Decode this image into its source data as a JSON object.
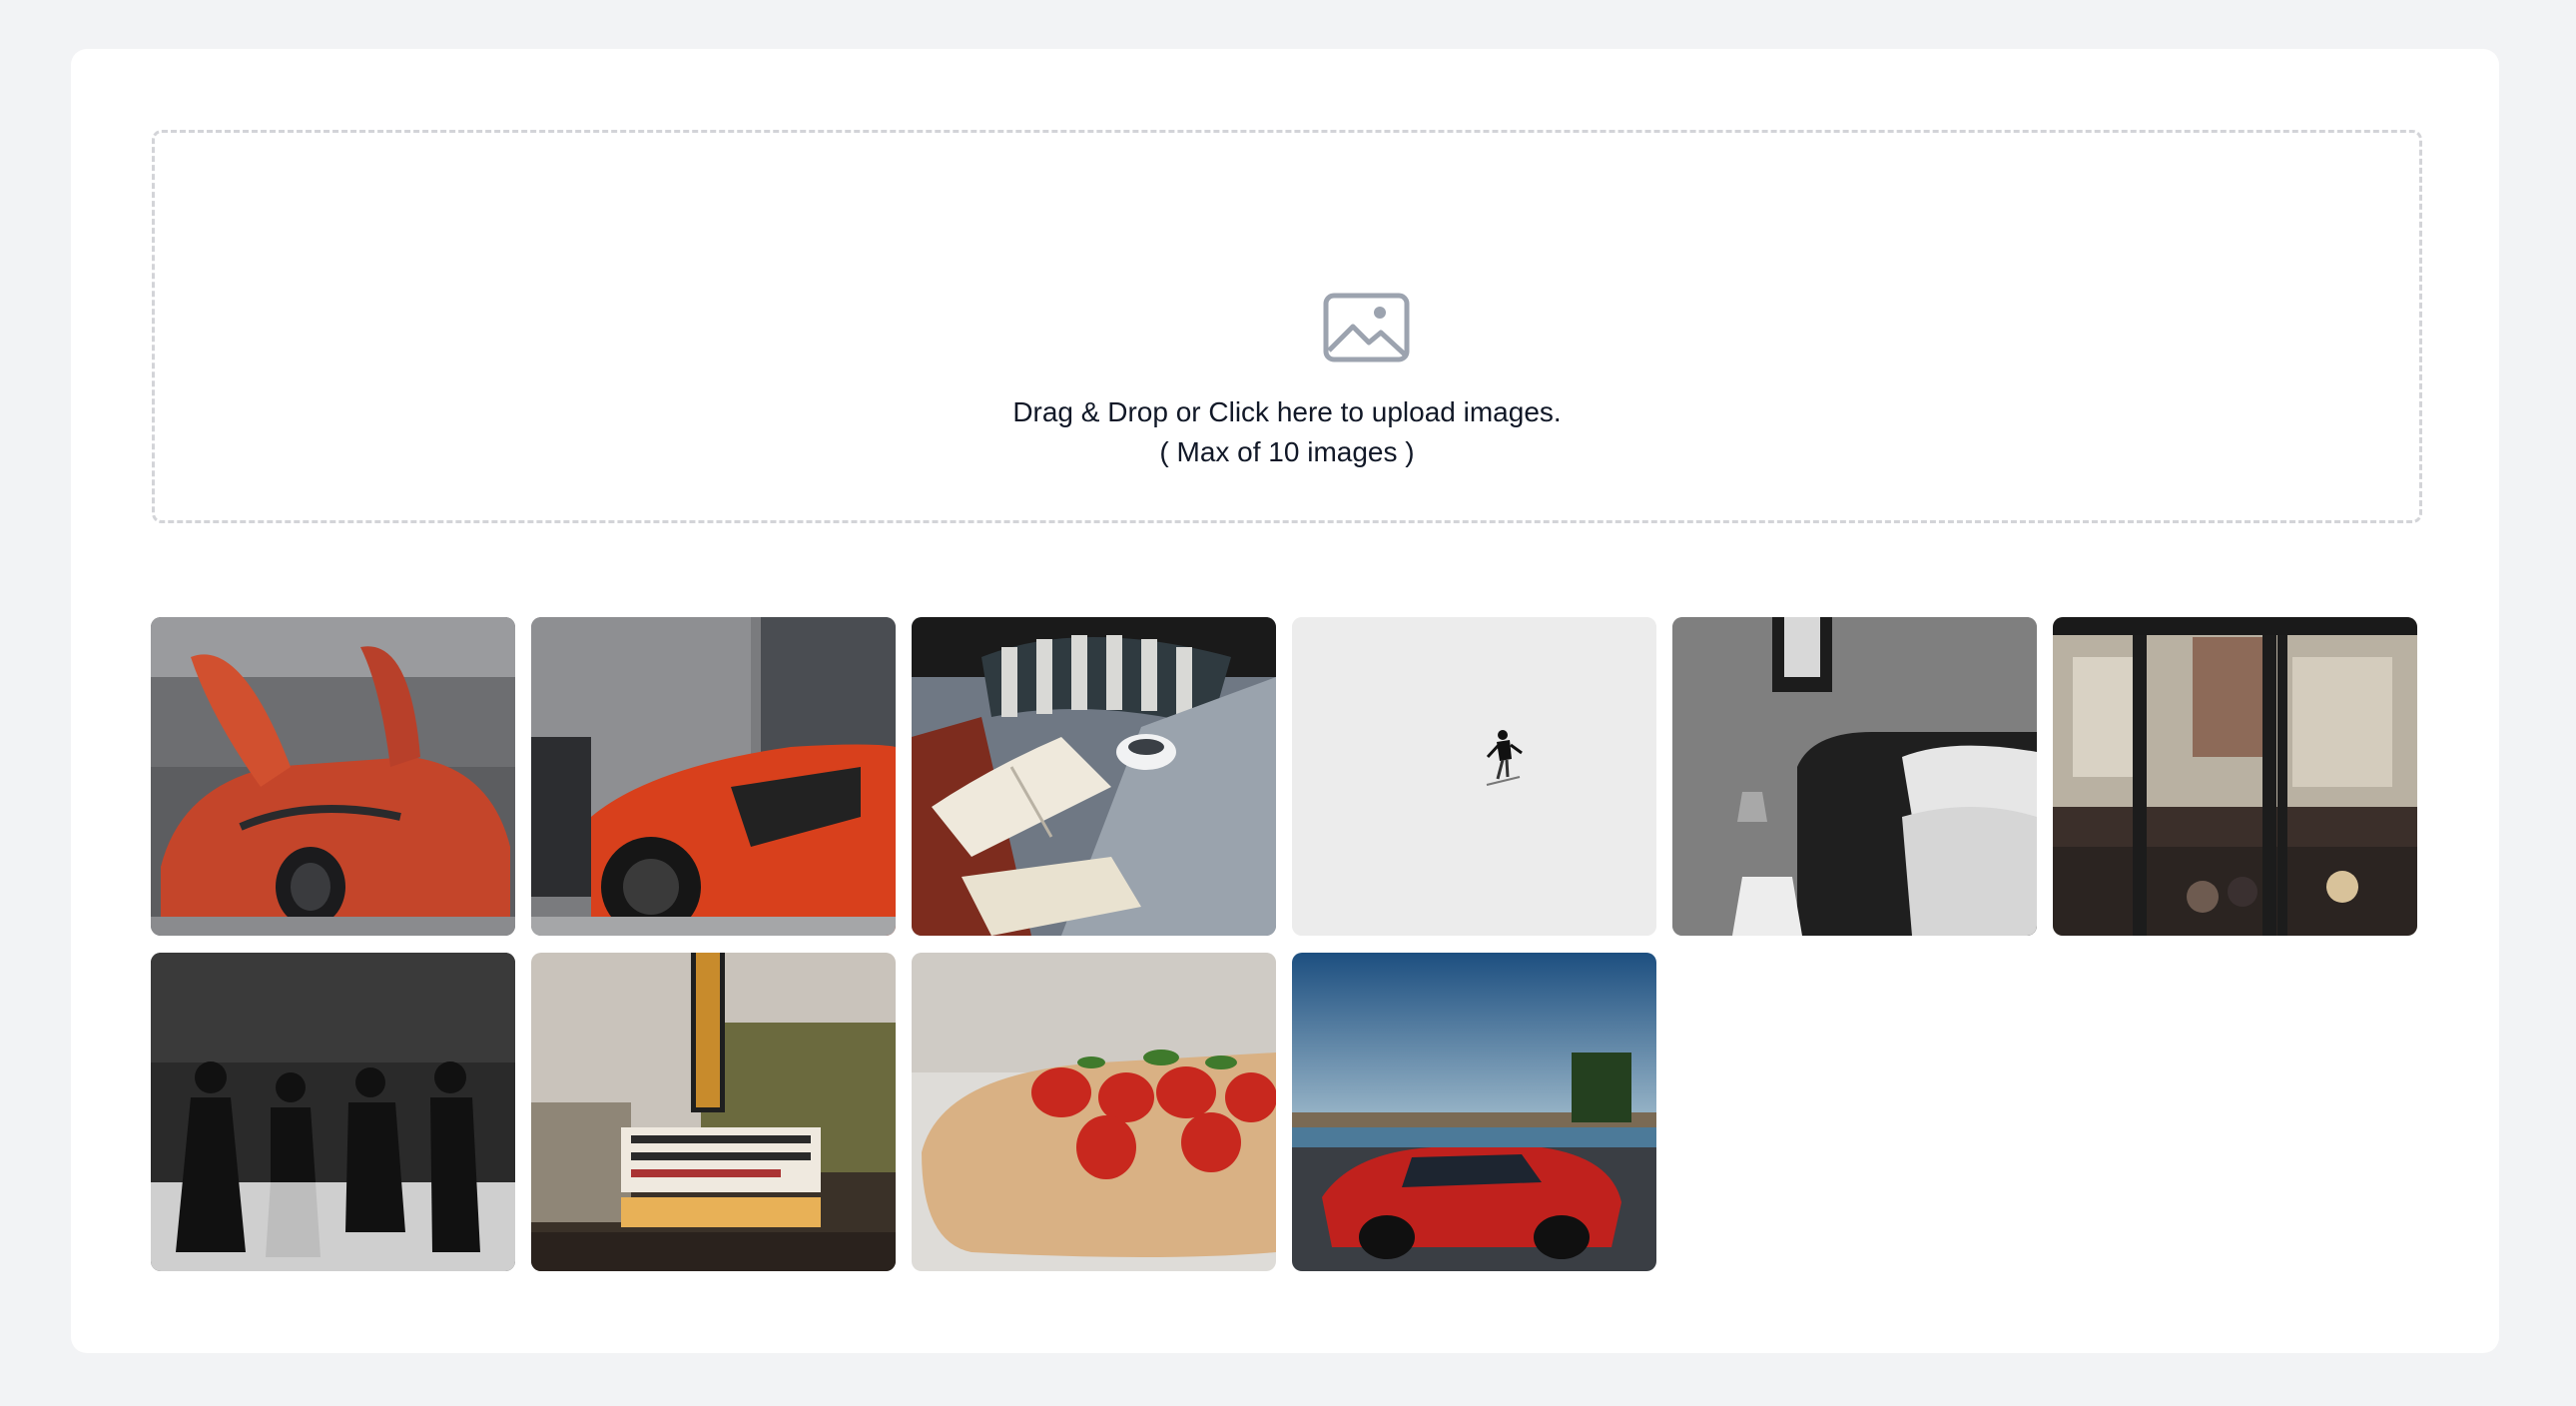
{
  "upload": {
    "icon": "image-icon",
    "instruction": "Drag & Drop or Click here to upload images.",
    "limit": "( Max of 10 images )"
  },
  "gallery": {
    "images": [
      {
        "subject": "red-supercar-doors-open"
      },
      {
        "subject": "orange-sports-car-side"
      },
      {
        "subject": "open-book-on-bed"
      },
      {
        "subject": "skier-on-snow"
      },
      {
        "subject": "bedroom-pillows-lamp"
      },
      {
        "subject": "street-through-glass-door"
      },
      {
        "subject": "four-people-black-and-white"
      },
      {
        "subject": "county-theater-marquee"
      },
      {
        "subject": "strawberries-on-cutting-board"
      },
      {
        "subject": "red-sports-car-by-river"
      }
    ]
  },
  "colors": {
    "page_background": "#f2f3f5",
    "card_background": "#ffffff",
    "dropzone_border": "#d3d4d8",
    "icon": "#9ca3af",
    "text": "#111827"
  }
}
